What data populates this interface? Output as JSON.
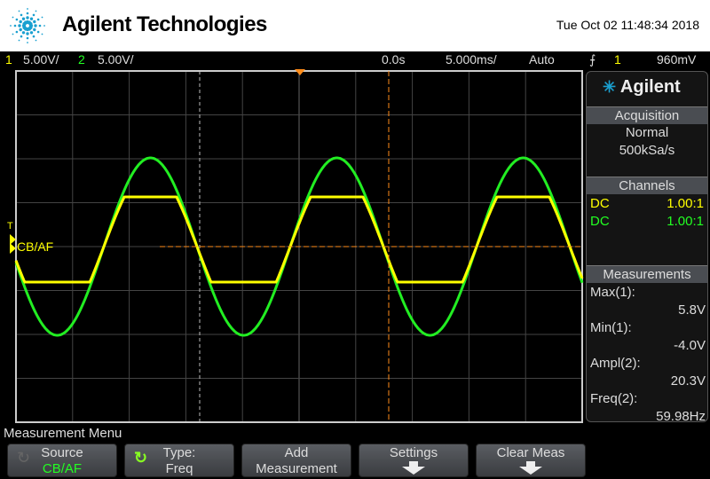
{
  "header": {
    "brand": "Agilent Technologies",
    "datetime": "Tue Oct 02 11:48:34 2018"
  },
  "status": {
    "ch1_num": "1",
    "ch1_scale": "5.00V/",
    "ch2_num": "2",
    "ch2_scale": "5.00V/",
    "delay": "0.0s",
    "timebase": "5.000ms/",
    "trigger_mode": "Auto",
    "trigger_source": "1",
    "trigger_level": "960mV"
  },
  "screen": {
    "ground_label": "CB/AF",
    "ch1_color": "#ffff00",
    "ch2_color": "#22ee22",
    "cursor_color": "#ff8c1a"
  },
  "side": {
    "logo": "Agilent",
    "acquisition": {
      "title": "Acquisition",
      "mode": "Normal",
      "rate": "500kSa/s"
    },
    "channels": {
      "title": "Channels",
      "rows": [
        {
          "coupling": "DC",
          "probe": "1.00:1"
        },
        {
          "coupling": "DC",
          "probe": "1.00:1"
        }
      ]
    },
    "measurements": {
      "title": "Measurements",
      "items": [
        {
          "label": "Max(1):",
          "value": "5.8V"
        },
        {
          "label": "Min(1):",
          "value": "-4.0V"
        },
        {
          "label": "Ampl(2):",
          "value": "20.3V"
        },
        {
          "label": "Freq(2):",
          "value": "59.98Hz"
        }
      ]
    }
  },
  "menu": {
    "title": "Measurement Menu",
    "softkeys": [
      {
        "top": "Source",
        "bottom": "CB/AF"
      },
      {
        "top": "Type:",
        "bottom": "Freq"
      },
      {
        "top": "Add",
        "bottom": "Measurement"
      },
      {
        "top": "Settings"
      },
      {
        "top": "Clear Meas"
      }
    ]
  }
}
